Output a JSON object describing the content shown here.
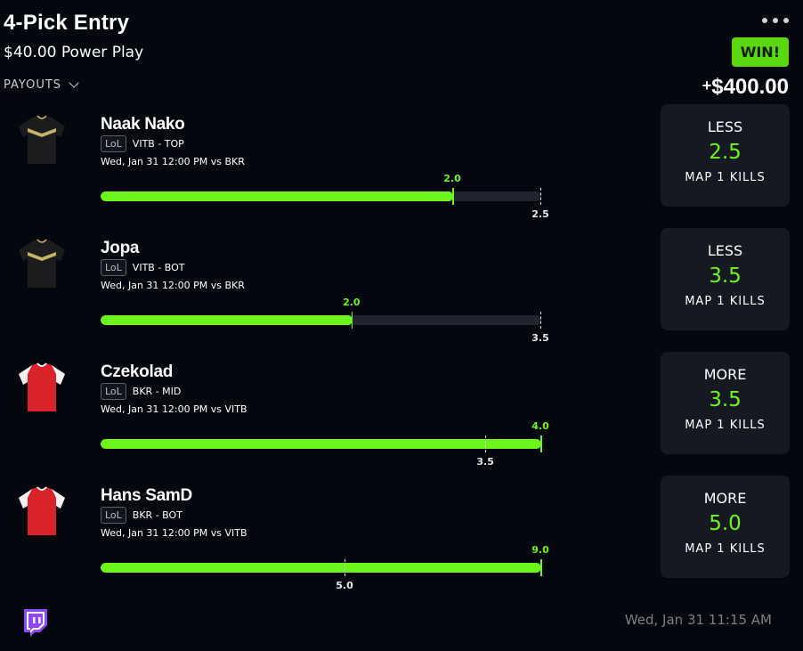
{
  "header": {
    "title": "4-Pick Entry",
    "subtitle": "$40.00 Power Play",
    "payouts_label": "PAYOUTS",
    "result_badge": "WIN!",
    "winnings_sign": "+",
    "winnings_amount": "$400.00"
  },
  "picks": [
    {
      "player": "Naak Nako",
      "league": "LoL",
      "team_position": "VITB - TOP",
      "game_info": "Wed, Jan 31 12:00 PM  vs BKR",
      "actual": 2.0,
      "actual_label": "2.0",
      "line": 2.5,
      "line_label": "2.5",
      "direction": "LESS",
      "value": "2.5",
      "stat": "MAP 1 KILLS",
      "jersey": "dark"
    },
    {
      "player": "Jopa",
      "league": "LoL",
      "team_position": "VITB - BOT",
      "game_info": "Wed, Jan 31 12:00 PM  vs BKR",
      "actual": 2.0,
      "actual_label": "2.0",
      "line": 3.5,
      "line_label": "3.5",
      "direction": "LESS",
      "value": "3.5",
      "stat": "MAP 1 KILLS",
      "jersey": "dark"
    },
    {
      "player": "Czekolad",
      "league": "LoL",
      "team_position": "BKR - MID",
      "game_info": "Wed, Jan 31 12:00 PM  vs VITB",
      "actual": 4.0,
      "actual_label": "4.0",
      "line": 3.5,
      "line_label": "3.5",
      "direction": "MORE",
      "value": "3.5",
      "stat": "MAP 1 KILLS",
      "jersey": "red"
    },
    {
      "player": "Hans SamD",
      "league": "LoL",
      "team_position": "BKR - BOT",
      "game_info": "Wed, Jan 31 12:00 PM  vs VITB",
      "actual": 9.0,
      "actual_label": "9.0",
      "line": 5.0,
      "line_label": "5.0",
      "direction": "MORE",
      "value": "5.0",
      "stat": "MAP 1 KILLS",
      "jersey": "red"
    }
  ],
  "footer": {
    "timestamp": "Wed, Jan 31 11:15 AM",
    "icon": "twitch-icon"
  },
  "colors": {
    "accent": "#6cf51c",
    "win_badge": "#59d80f",
    "card_bg": "#161922",
    "twitch": "#9146ff"
  }
}
